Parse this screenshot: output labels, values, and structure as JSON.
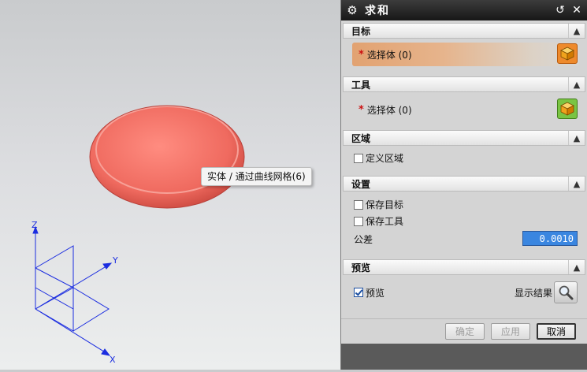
{
  "tooltip": {
    "text": "实体 / 通过曲线网格(6)"
  },
  "triad": {
    "x_label": "X",
    "y_label": "Y",
    "z_label": "Z"
  },
  "dialog": {
    "title": "求和",
    "sections": {
      "target": {
        "label": "目标",
        "select_label": "选择体 (0)",
        "required_mark": "*"
      },
      "tool": {
        "label": "工具",
        "select_label": "选择体 (0)",
        "required_mark": "*"
      },
      "region": {
        "label": "区域",
        "define_region": {
          "label": "定义区域",
          "checked": false
        }
      },
      "settings": {
        "label": "设置",
        "keep_target": {
          "label": "保存目标",
          "checked": false
        },
        "keep_tool": {
          "label": "保存工具",
          "checked": false
        },
        "tolerance_label": "公差",
        "tolerance_value": "0.0010"
      },
      "preview": {
        "label": "预览",
        "preview_checkbox": {
          "label": "预览",
          "checked": true
        },
        "show_result_label": "显示结果"
      }
    },
    "buttons": {
      "ok": "确定",
      "apply": "应用",
      "cancel": "取消"
    }
  },
  "colors": {
    "body_fill": "#ef6a5f",
    "triad_blue": "#1b2de0",
    "target_highlight": "#e2a271"
  }
}
